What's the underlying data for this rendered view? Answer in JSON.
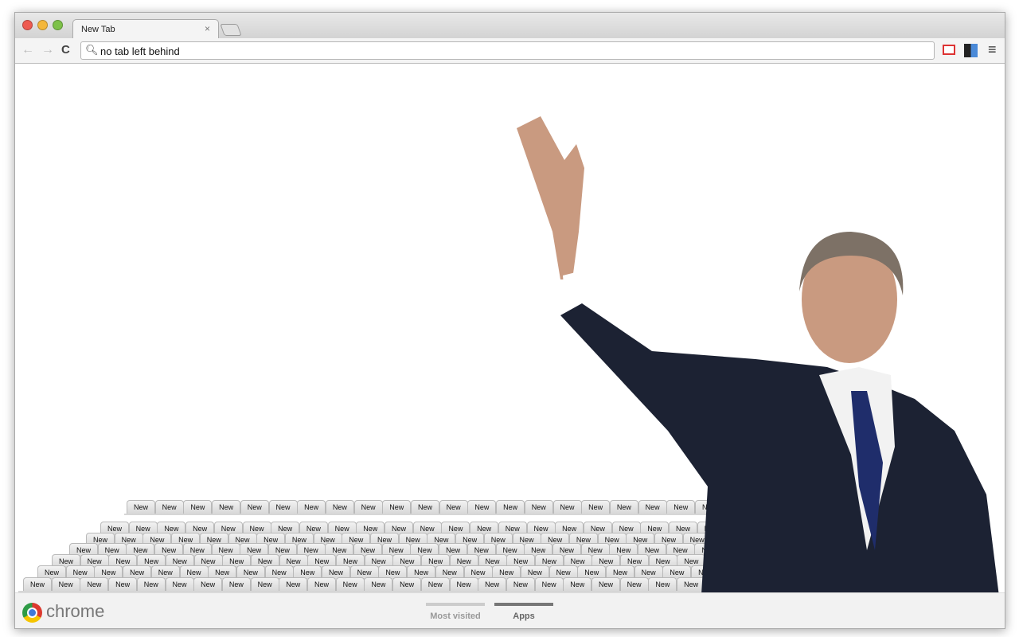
{
  "window": {
    "tab_title": "New Tab",
    "tab_close": "×"
  },
  "toolbar": {
    "omnibox_value": "no tab left behind",
    "back": "←",
    "forward": "→",
    "reload": "C",
    "menu": "≡"
  },
  "content": {
    "stacked_tab_label": "New",
    "tab_rows": [
      21,
      22,
      23,
      24,
      25,
      26,
      26
    ]
  },
  "footer": {
    "brand": "chrome",
    "tabs": [
      {
        "label": "Most visited",
        "active": false
      },
      {
        "label": "Apps",
        "active": true
      }
    ]
  },
  "colors": {
    "suit": "#1c2233",
    "tie": "#1f2d6b",
    "skin": "#c99a80"
  }
}
